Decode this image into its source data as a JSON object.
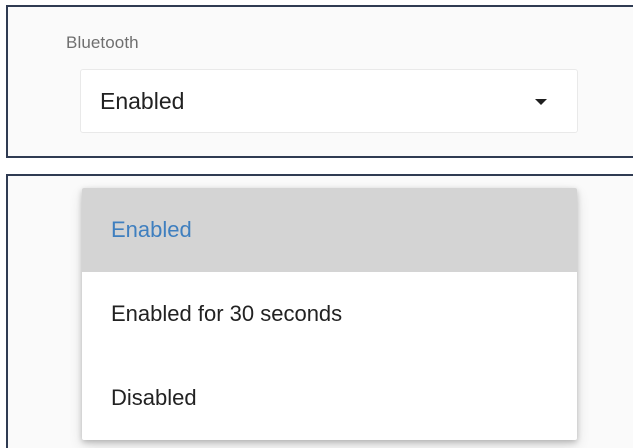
{
  "bluetooth": {
    "label": "Bluetooth",
    "value": "Enabled"
  },
  "menu": {
    "options": [
      {
        "label": "Enabled",
        "selected": true
      },
      {
        "label": "Enabled for 30 seconds",
        "selected": false
      },
      {
        "label": "Disabled",
        "selected": false
      }
    ]
  },
  "colors": {
    "selected_text": "#3f7fbf",
    "selected_bg": "#d4d4d4",
    "frame_border": "#2f3b52"
  },
  "icons": {
    "dropdown": "caret-down-icon"
  }
}
